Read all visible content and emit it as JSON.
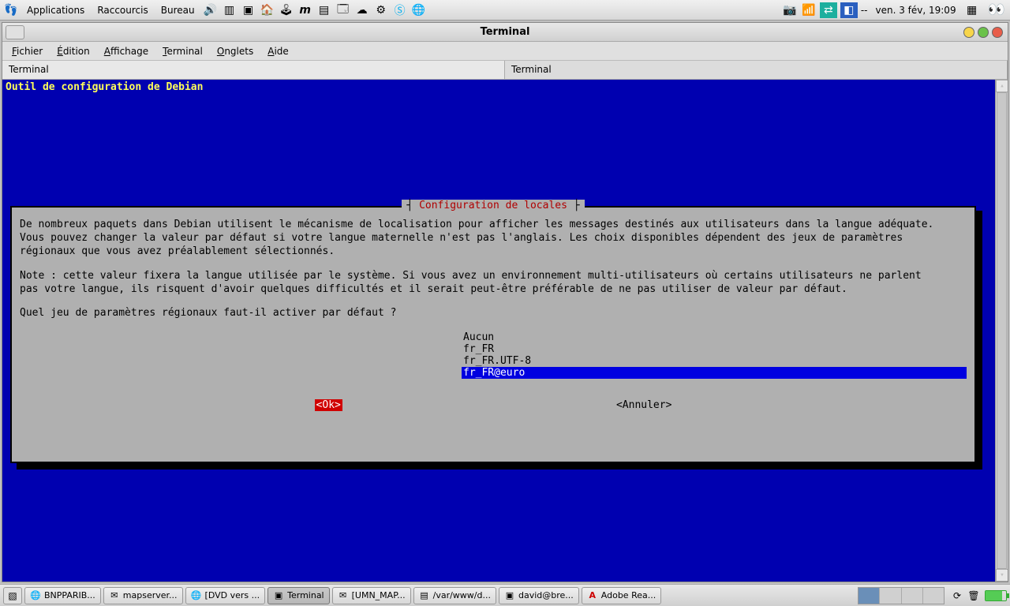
{
  "panel": {
    "apps": [
      "Applications",
      "Raccourcis",
      "Bureau"
    ],
    "clock": "ven.  3 fév, 19:09",
    "separator": "--"
  },
  "window": {
    "title": "Terminal",
    "menus": [
      {
        "label": "Fichier",
        "u": "F",
        "rest": "ichier"
      },
      {
        "label": "Édition",
        "u": "É",
        "rest": "dition"
      },
      {
        "label": "Affichage",
        "u": "A",
        "rest": "ffichage"
      },
      {
        "label": "Terminal",
        "u": "T",
        "rest": "erminal"
      },
      {
        "label": "Onglets",
        "u": "O",
        "rest": "nglets"
      },
      {
        "label": "Aide",
        "u": "A",
        "rest": "ide"
      }
    ],
    "tabs": [
      "Terminal",
      "Terminal"
    ],
    "active_tab": 0
  },
  "terminal": {
    "header": "Outil de configuration de Debian"
  },
  "dialog": {
    "title": "Configuration de locales",
    "para1": "De nombreux paquets dans Debian utilisent le mécanisme de localisation pour afficher les messages destinés aux utilisateurs dans la langue adéquate.\nVous pouvez changer la valeur par défaut si votre langue maternelle n'est pas l'anglais. Les choix disponibles dépendent des jeux de paramètres\nrégionaux que vous avez préalablement sélectionnés.",
    "para2": "Note : cette valeur fixera la langue utilisée par le système. Si vous avez un environnement multi-utilisateurs où certains utilisateurs ne parlent\npas votre langue, ils risquent d'avoir quelques difficultés et il serait peut-être préférable de ne pas utiliser de valeur par défaut.",
    "question": "Quel jeu de paramètres régionaux faut-il activer par défaut ?",
    "options": [
      "Aucun",
      "fr_FR",
      "fr_FR.UTF-8",
      "fr_FR@euro"
    ],
    "selected_index": 3,
    "ok": "<Ok>",
    "cancel": "<Annuler>"
  },
  "taskbar": {
    "tasks": [
      {
        "label": "BNPPARIB...",
        "icon": "🌐"
      },
      {
        "label": "mapserver...",
        "icon": "✉"
      },
      {
        "label": "[DVD vers ...",
        "icon": "🌐"
      },
      {
        "label": "Terminal",
        "icon": "▣",
        "active": true
      },
      {
        "label": "[UMN_MAP...",
        "icon": "✉"
      },
      {
        "label": "/var/www/d...",
        "icon": "▤"
      },
      {
        "label": "david@bre...",
        "icon": "▣"
      },
      {
        "label": "Adobe Rea...",
        "icon": "A"
      }
    ]
  }
}
